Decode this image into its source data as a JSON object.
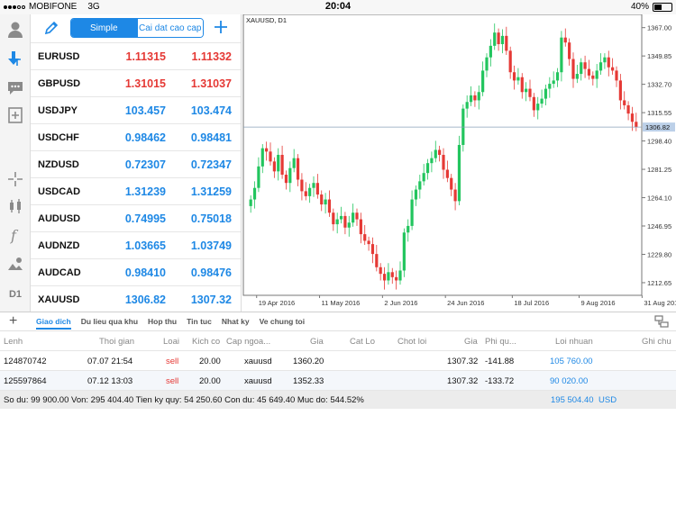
{
  "status_bar": {
    "carrier": "MOBIFONE",
    "network": "3G",
    "time": "20:04",
    "battery": "40%"
  },
  "rail": {
    "icons": [
      "user-icon",
      "deposit-icon",
      "chat-icon",
      "new-order-icon",
      "crosshair-icon",
      "candlestick-icon",
      "function-icon",
      "objects-icon"
    ],
    "timeframe": "D1"
  },
  "quotes": {
    "tab_simple": "Simple",
    "tab_advanced": "Cai dat cao cap",
    "rows": [
      {
        "symbol": "EURUSD",
        "bid": "1.11315",
        "ask": "1.11332",
        "color": "#e53935"
      },
      {
        "symbol": "GBPUSD",
        "bid": "1.31015",
        "ask": "1.31037",
        "color": "#e53935"
      },
      {
        "symbol": "USDJPY",
        "bid": "103.457",
        "ask": "103.474",
        "color": "#1e88e5"
      },
      {
        "symbol": "USDCHF",
        "bid": "0.98462",
        "ask": "0.98481",
        "color": "#1e88e5"
      },
      {
        "symbol": "NZDUSD",
        "bid": "0.72307",
        "ask": "0.72347",
        "color": "#1e88e5"
      },
      {
        "symbol": "USDCAD",
        "bid": "1.31239",
        "ask": "1.31259",
        "color": "#1e88e5"
      },
      {
        "symbol": "AUDUSD",
        "bid": "0.74995",
        "ask": "0.75018",
        "color": "#1e88e5"
      },
      {
        "symbol": "AUDNZD",
        "bid": "1.03665",
        "ask": "1.03749",
        "color": "#1e88e5"
      },
      {
        "symbol": "AUDCAD",
        "bid": "0.98410",
        "ask": "0.98476",
        "color": "#1e88e5"
      },
      {
        "symbol": "XAUUSD",
        "bid": "1306.82",
        "ask": "1307.32",
        "color": "#1e88e5"
      }
    ]
  },
  "chart_data": {
    "type": "candlestick",
    "title": "XAUUSD, D1",
    "ylim": [
      1205,
      1375
    ],
    "y_ticks": [
      "1367.00",
      "1349.85",
      "1332.70",
      "1315.55",
      "1298.40",
      "1281.25",
      "1264.10",
      "1246.95",
      "1229.80",
      "1212.65"
    ],
    "y_tick_values": [
      1367.0,
      1349.85,
      1332.7,
      1315.55,
      1298.4,
      1281.25,
      1264.1,
      1246.95,
      1229.8,
      1212.65
    ],
    "x_ticks": [
      "19 Apr 2016",
      "11 May 2016",
      "2 Jun 2016",
      "24 Jun 2016",
      "18 Jul 2016",
      "9 Aug 2016",
      "31 Aug 2016"
    ],
    "current_price": "1306.82",
    "current_price_value": 1306.82,
    "up_color": "#22c55e",
    "down_color": "#e53935",
    "closes": [
      1263,
      1270,
      1283,
      1294,
      1292,
      1286,
      1280,
      1290,
      1278,
      1273,
      1282,
      1288,
      1275,
      1268,
      1265,
      1270,
      1273,
      1266,
      1260,
      1263,
      1255,
      1248,
      1251,
      1253,
      1246,
      1249,
      1255,
      1251,
      1242,
      1238,
      1236,
      1230,
      1222,
      1218,
      1214,
      1219,
      1216,
      1214,
      1220,
      1243,
      1247,
      1263,
      1269,
      1274,
      1279,
      1285,
      1288,
      1293,
      1290,
      1281,
      1276,
      1269,
      1262,
      1296,
      1318,
      1322,
      1326,
      1323,
      1328,
      1341,
      1349,
      1356,
      1364,
      1357,
      1362,
      1353,
      1340,
      1335,
      1337,
      1328,
      1330,
      1325,
      1317,
      1321,
      1324,
      1330,
      1333,
      1335,
      1340,
      1361,
      1358,
      1348,
      1336,
      1339,
      1346,
      1342,
      1338,
      1336,
      1341,
      1346,
      1349,
      1343,
      1341,
      1335,
      1323,
      1320,
      1315,
      1310,
      1306.82
    ]
  },
  "tab_bar": {
    "tabs": [
      "Giao dich",
      "Du lieu qua khu",
      "Hop thu",
      "Tin tuc",
      "Nhat ky",
      "Ve chung toi"
    ],
    "active": 0
  },
  "trades": {
    "headers": {
      "order": "Lenh",
      "time": "Thoi gian",
      "type": "Loai",
      "volume": "Kich co",
      "symbol": "Cap ngoa...",
      "price": "Gia",
      "sl": "Cat Lo",
      "tp": "Chot loi",
      "cur_price": "Gia",
      "swap": "Phi qu...",
      "profit": "Loi nhuan",
      "comment": "Ghi chu"
    },
    "rows": [
      {
        "order": "124870742",
        "time": "07.07 21:54",
        "type": "sell",
        "volume": "20.00",
        "symbol": "xauusd",
        "price": "1360.20",
        "cur_price": "1307.32",
        "swap": "-141.88",
        "profit": "105 760.00"
      },
      {
        "order": "125597864",
        "time": "07.12 13:03",
        "type": "sell",
        "volume": "20.00",
        "symbol": "xauusd",
        "price": "1352.33",
        "cur_price": "1307.32",
        "swap": "-133.72",
        "profit": "90 020.00"
      }
    ],
    "summary": "So du: 99 900.00 Von: 295 404.40 Tien ky quy: 54 250.60 Con du: 45 649.40 Muc do: 544.52%",
    "total_profit": "195 504.40",
    "currency": "USD"
  }
}
